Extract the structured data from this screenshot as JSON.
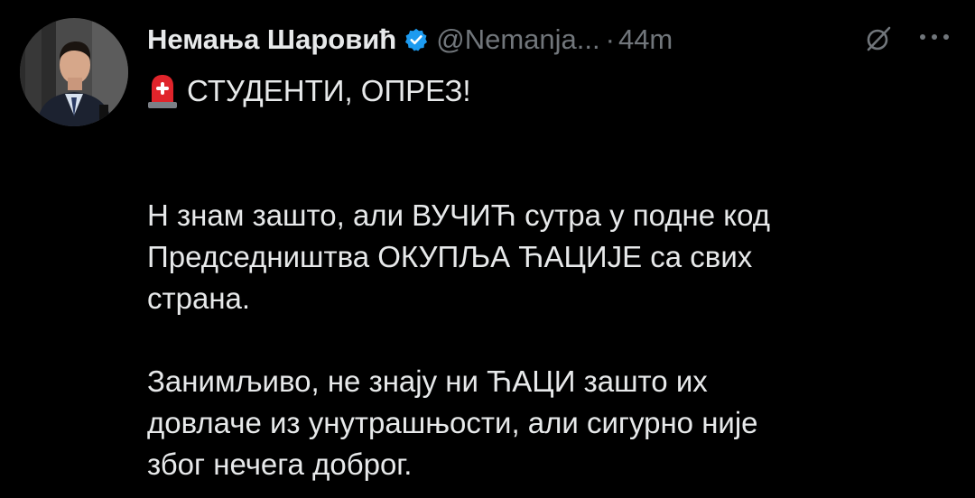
{
  "tweet": {
    "display_name": "Немања Шаровић",
    "handle": "@Nemanja...",
    "separator": "·",
    "time": "44m",
    "headline": "СТУДЕНТИ, ОПРЕЗ!",
    "paragraph1": [
      "Н знам зашто, али ВУЧИЋ сутра у подне код",
      "Председништва ОКУПЉА ЋАЦИЈЕ са свих",
      "страна."
    ],
    "paragraph2": [
      "Занимљиво, не знају ни ЋАЦИ зашто их",
      "довлаче из унутрашњости, али сигурно није",
      "због нечега доброг."
    ]
  },
  "icons": {
    "verified": "verified-badge-icon",
    "grok": "grok-icon",
    "more": "more-options-icon",
    "siren": "police-light-emoji"
  },
  "colors": {
    "background": "#000000",
    "text": "#e7e9ea",
    "muted": "#71767b",
    "verified_blue": "#1d9bf0",
    "siren_red": "#e0242b"
  }
}
